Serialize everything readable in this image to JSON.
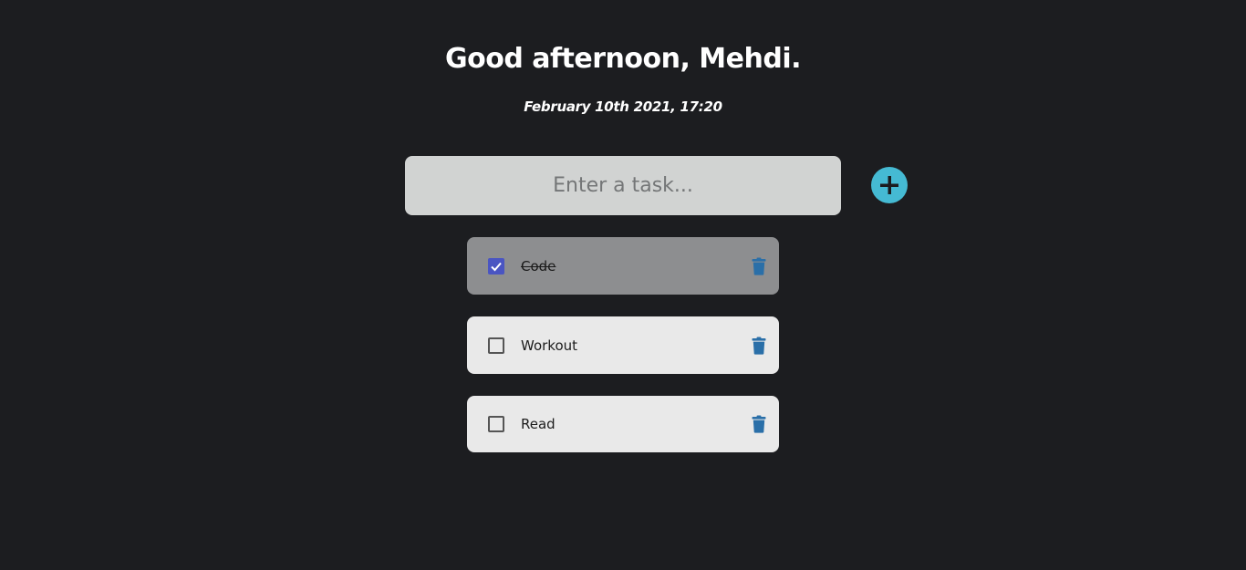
{
  "header": {
    "greeting": "Good afternoon, Mehdi.",
    "datetime": "February 10th 2021, 17:20"
  },
  "task_form": {
    "placeholder": "Enter a task...",
    "value": "",
    "add_icon": "plus-icon",
    "add_color": "#45bad3"
  },
  "tasks": [
    {
      "label": "Code",
      "completed": true,
      "delete_icon": "trash-icon"
    },
    {
      "label": "Workout",
      "completed": false,
      "delete_icon": "trash-icon"
    },
    {
      "label": "Read",
      "completed": false,
      "delete_icon": "trash-icon"
    }
  ],
  "colors": {
    "background": "#1c1d20",
    "input_background": "#d1d3d2",
    "task_background": "#e9e9e9",
    "task_done_background": "#8d8e90",
    "checkbox_checked": "#4a55c2",
    "trash": "#2a6fa8"
  }
}
